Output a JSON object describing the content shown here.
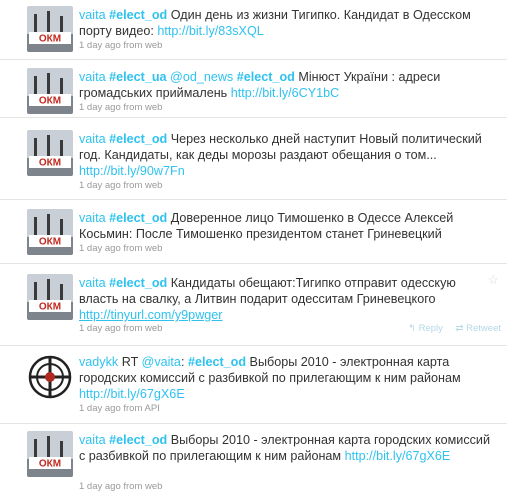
{
  "tweets": [
    {
      "avatar": "okm-logo",
      "user": "vaita",
      "hashtag": "#elect_od",
      "text_a": " Один день из жизни Тигипко. Кандидат в Одесском порту видео: ",
      "url": "http://bit.ly/83sXQL",
      "time": "1 day ago",
      "source": "from web"
    },
    {
      "avatar": "okm-logo",
      "user": "vaita",
      "hashtag": "#elect_ua",
      "mention": "@od_news",
      "hashtag2": "#elect_od",
      "text_a": " Мінюст України : адреси громадських приймалень ",
      "url": "http://bit.ly/6CY1bC",
      "time": "1 day ago",
      "source": "from web"
    },
    {
      "avatar": "okm-logo",
      "user": "vaita",
      "hashtag": "#elect_od",
      "text_a": " Через несколько дней наступит Новый политический год. Кандидаты, как деды морозы раздают обещания о том... ",
      "url": "http://bit.ly/90w7Fn",
      "time": "1 day ago",
      "source": "from web"
    },
    {
      "avatar": "okm-logo",
      "user": "vaita",
      "hashtag": "#elect_od",
      "text_a": " Доверенное лицо Тимошенко в Одессе Алексей Косьмин: После Тимошенко президентом станет Гриневецкий",
      "time": "1 day ago",
      "source": "from web"
    },
    {
      "avatar": "okm-logo",
      "user": "vaita",
      "hashtag": "#elect_od",
      "text_a": " Кандидаты обещают:Тигипко отправит одесскую власть на свалку, а Литвин подарит одесситам Гриневецкого ",
      "url": "http://tinyurl.com/y9pwger",
      "time": "1 day ago",
      "source": "from web",
      "reply_label": "Reply",
      "retweet_label": "Retweet"
    },
    {
      "avatar": "vadykk-logo",
      "user": "vadykk",
      "rt_prefix": "RT ",
      "mention": "@vaita",
      "mention_suffix": ": ",
      "hashtag": "#elect_od",
      "text_a": " Выборы 2010 - электронная карта городских комиссий с разбивкой по прилегающим к ним районам ",
      "url": "http://bit.ly/67gX6E",
      "time": "1 day ago",
      "source": "from API"
    },
    {
      "avatar": "okm-logo",
      "user": "vaita",
      "hashtag": "#elect_od",
      "text_a": " Выборы 2010 - электронная карта городских комиссий с разбивкой по прилегающим к ним районам ",
      "url": "http://bit.ly/67gX6E",
      "time": "1 day ago",
      "source": "from web"
    }
  ],
  "colors": {
    "link": "#2fc2ef",
    "text": "#333333",
    "meta": "#9a9a9a",
    "divider": "#e4e4e4"
  }
}
